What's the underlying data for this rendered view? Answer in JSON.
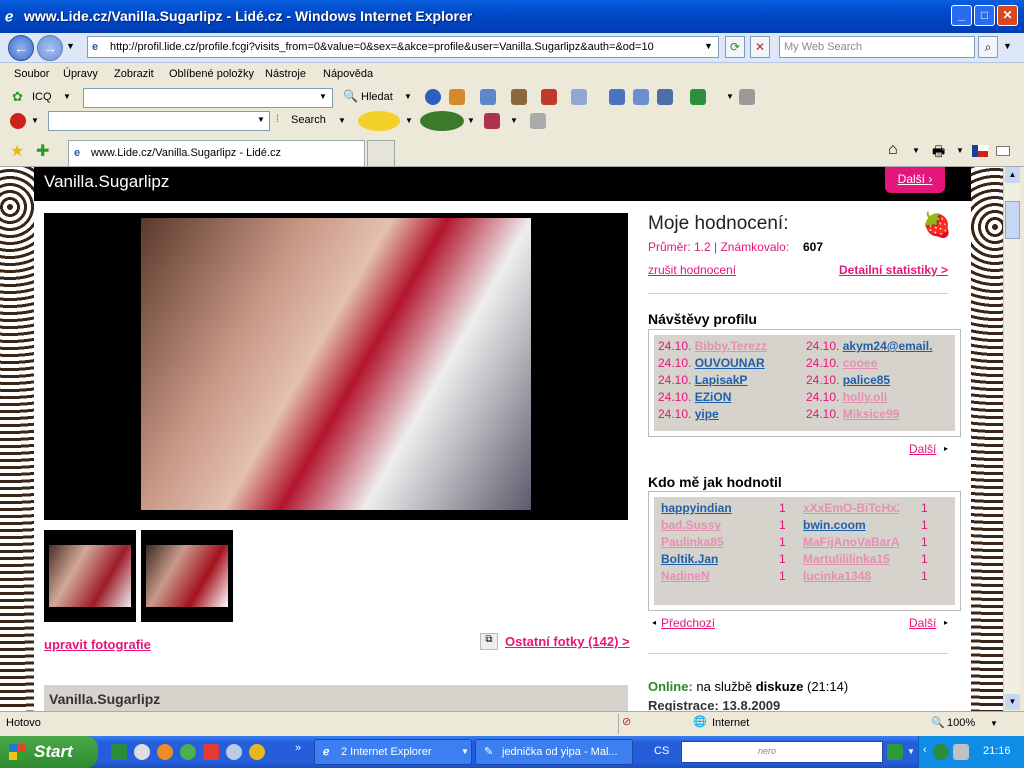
{
  "window": {
    "title": "www.Lide.cz/Vanilla.Sugarlipz - Lidé.cz - Windows Internet Explorer"
  },
  "address": {
    "url": "http://profil.lide.cz/profile.fcgi?visits_from=0&value=0&sex=&akce=profile&user=Vanilla.Sugarlipz&auth=&od=10",
    "search_placeholder": "My Web Search"
  },
  "menu": [
    "Soubor",
    "Úpravy",
    "Zobrazit",
    "Oblíbené položky",
    "Nástroje",
    "Nápověda"
  ],
  "toolbar": {
    "icq": "ICQ",
    "hledat": "Hledat",
    "search": "Search"
  },
  "tab": {
    "title": "www.Lide.cz/Vanilla.Sugarlipz - Lidé.cz"
  },
  "profile": {
    "name": "Vanilla.Sugarlipz",
    "header_next": "Další",
    "edit_photos": "upravit fotografie",
    "other_photos": "Ostatní fotky (142) >",
    "section_name": "Vanilla.Sugarlipz"
  },
  "rating": {
    "heading": "Moje hodnocení:",
    "avg_label": "Průměr: 1.2 | Známkovalo:",
    "count": "607",
    "cancel": "zrušit hodnocení",
    "stats": "Detailní statistiky >"
  },
  "visits": {
    "heading": "Návštěvy profilu",
    "left": [
      {
        "date": "24.10.",
        "user": "Bibby.Terezz",
        "style": "grey"
      },
      {
        "date": "24.10.",
        "user": "OUVOUNAR",
        "style": "blue"
      },
      {
        "date": "24.10.",
        "user": "LapisakP",
        "style": "blue"
      },
      {
        "date": "24.10.",
        "user": "EZiON",
        "style": "blue"
      },
      {
        "date": "24.10.",
        "user": "yipe",
        "style": "blue"
      }
    ],
    "right": [
      {
        "date": "24.10.",
        "user": "akym24@email.",
        "style": "blue"
      },
      {
        "date": "24.10.",
        "user": "cooee",
        "style": "grey"
      },
      {
        "date": "24.10.",
        "user": "palice85",
        "style": "blue"
      },
      {
        "date": "24.10.",
        "user": "holly.oli",
        "style": "grey"
      },
      {
        "date": "24.10.",
        "user": "Miksice99",
        "style": "grey"
      }
    ],
    "next": "Další"
  },
  "raters": {
    "heading": "Kdo mě jak hodnotil",
    "left": [
      {
        "user": "happyindian",
        "score": "1",
        "style": "blue"
      },
      {
        "user": "bad.Sussy",
        "score": "1",
        "style": "grey"
      },
      {
        "user": "Paulinka85",
        "score": "1",
        "style": "grey"
      },
      {
        "user": "Boltik.Jan",
        "score": "1",
        "style": "blue"
      },
      {
        "user": "NadineN",
        "score": "1",
        "style": "grey"
      }
    ],
    "right": [
      {
        "user": "xXxEmO-BiTcHxXx",
        "score": "1",
        "style": "grey"
      },
      {
        "user": "bwin.coom",
        "score": "1",
        "style": "blue"
      },
      {
        "user": "MaFijAnoVaBarA",
        "score": "1",
        "style": "grey"
      },
      {
        "user": "Martulililinka15",
        "score": "1",
        "style": "grey"
      },
      {
        "user": "lucinka1348",
        "score": "1",
        "style": "grey"
      }
    ],
    "prev": "Předchozí",
    "next": "Další"
  },
  "online": {
    "label": "Online:",
    "text1": "na službě",
    "service": "diskuze",
    "time": "(21:14)",
    "reg": "Registrace: 13.8.2009"
  },
  "status": {
    "left": "Hotovo",
    "zone": "Internet",
    "zoom": "100%"
  },
  "taskbar": {
    "start": "Start",
    "tasks": [
      "2 Internet Explorer",
      "jednička od yipa - Mal..."
    ],
    "lang": "CS",
    "clock": "21:16"
  }
}
